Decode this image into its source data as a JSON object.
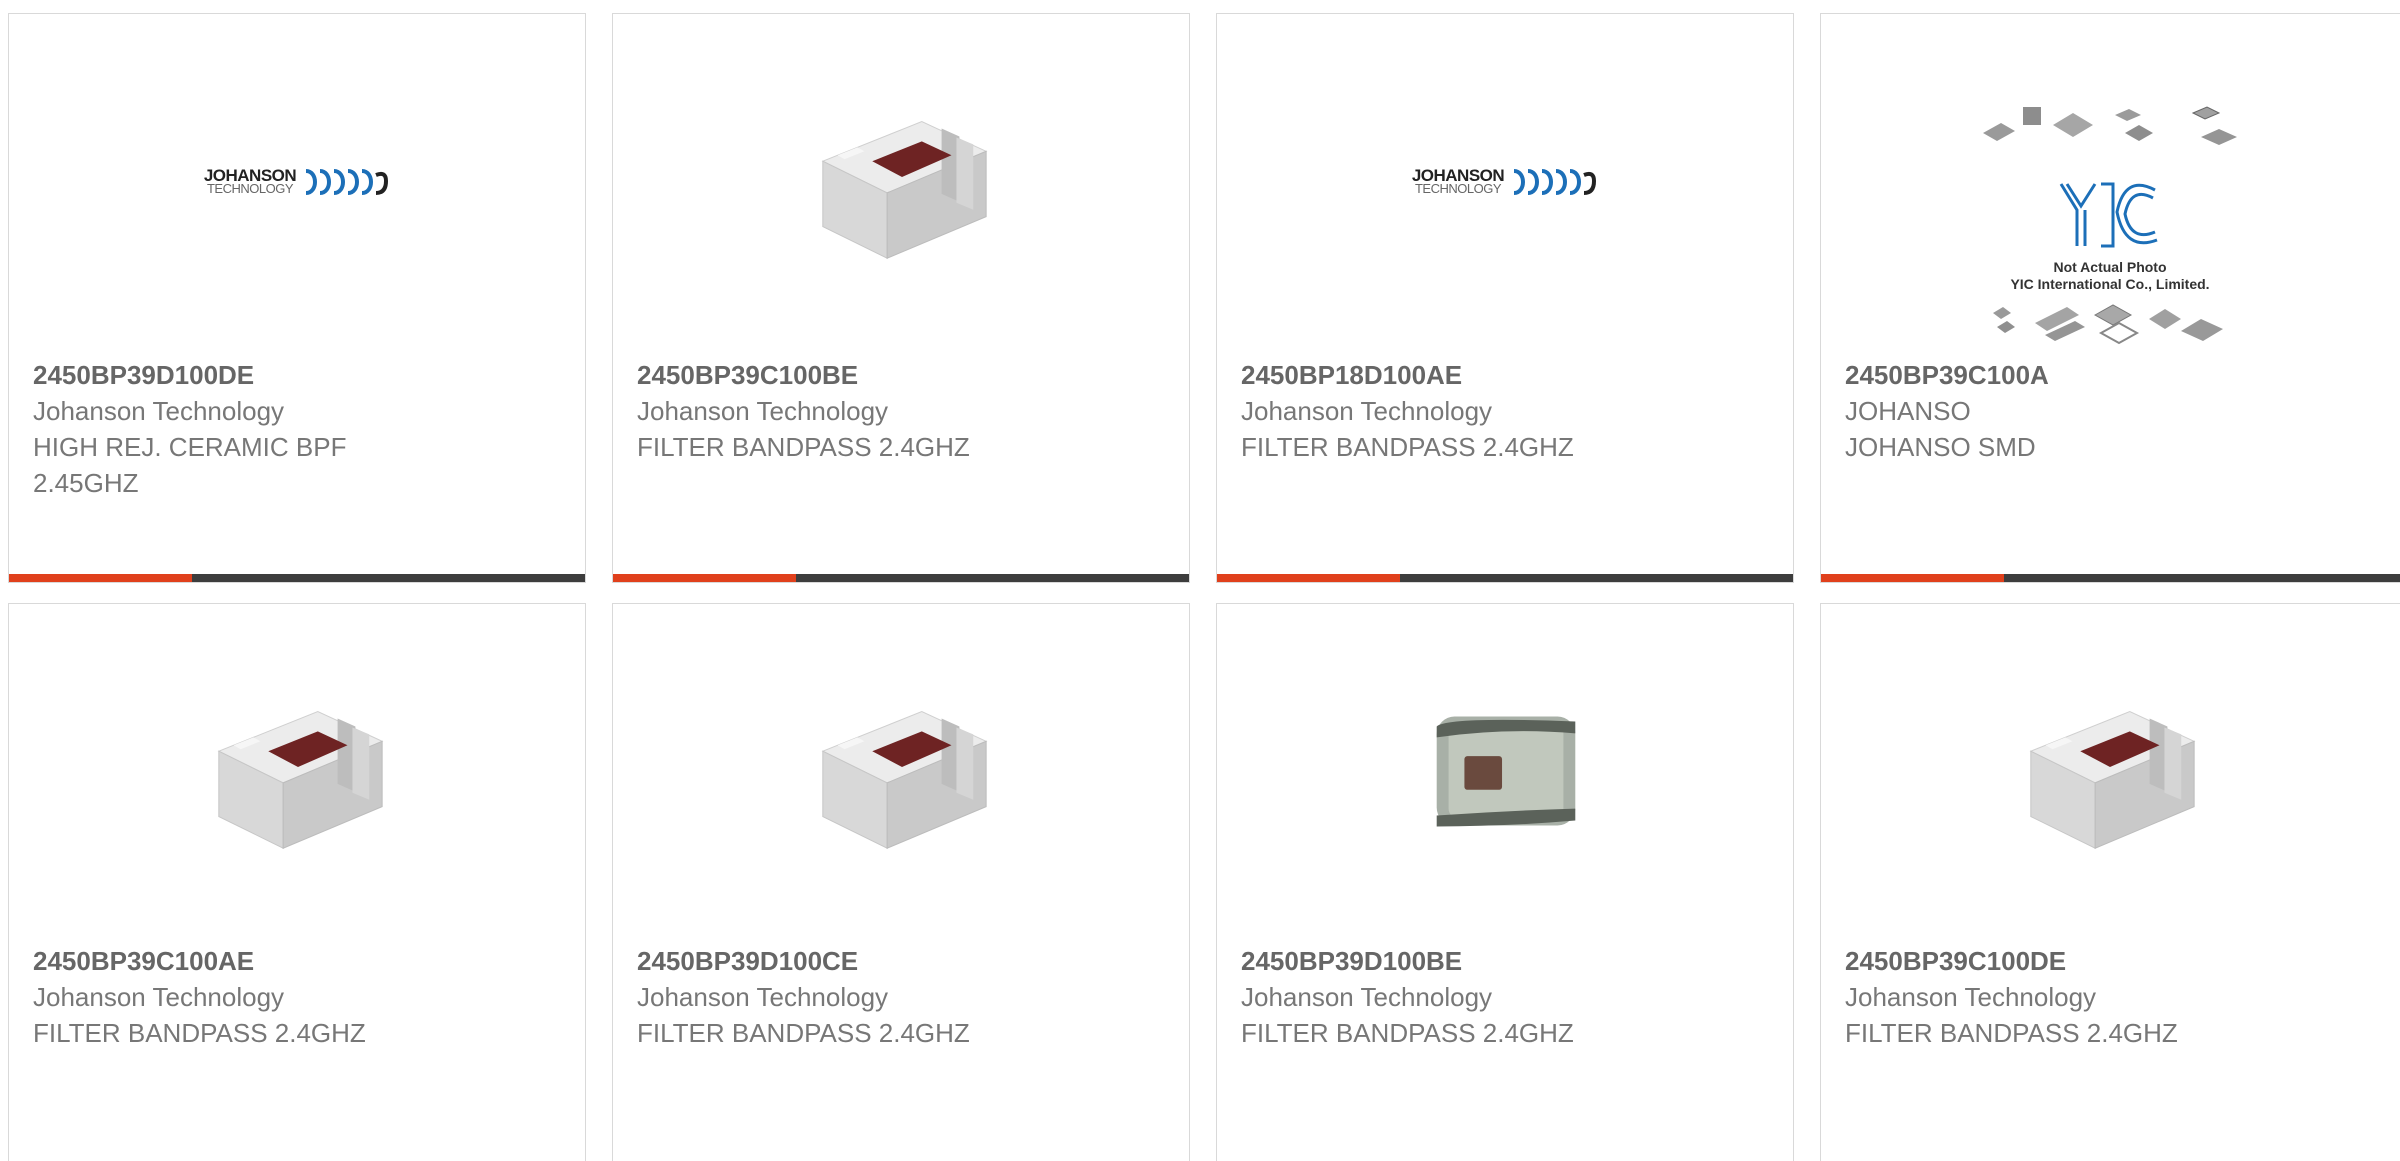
{
  "products": [
    {
      "part_number": "2450BP39D100DE",
      "manufacturer": "Johanson Technology",
      "description_lines": [
        "HIGH REJ. CERAMIC BPF",
        "2.45GHZ"
      ],
      "image": "johanson-logo",
      "logo_line1": "JOHANSON",
      "logo_line2": "TECHNOLOGY"
    },
    {
      "part_number": "2450BP39C100BE",
      "manufacturer": "Johanson Technology",
      "description_lines": [
        "FILTER BANDPASS 2.4GHZ"
      ],
      "image": "ceramic-chip-photo"
    },
    {
      "part_number": "2450BP18D100AE",
      "manufacturer": "Johanson Technology",
      "description_lines": [
        "FILTER BANDPASS 2.4GHZ"
      ],
      "image": "johanson-logo",
      "logo_line1": "JOHANSON",
      "logo_line2": "TECHNOLOGY"
    },
    {
      "part_number": "2450BP39C100A",
      "manufacturer": "JOHANSO",
      "description_lines": [
        "JOHANSO SMD"
      ],
      "image": "yic-placeholder",
      "placeholder_line1": "Not Actual Photo",
      "placeholder_line2": "YIC International Co., Limited."
    },
    {
      "part_number": "2450BP39C100AE",
      "manufacturer": "Johanson Technology",
      "description_lines": [
        "FILTER BANDPASS 2.4GHZ"
      ],
      "image": "ceramic-chip-photo"
    },
    {
      "part_number": "2450BP39D100CE",
      "manufacturer": "Johanson Technology",
      "description_lines": [
        "FILTER BANDPASS 2.4GHZ"
      ],
      "image": "ceramic-chip-photo"
    },
    {
      "part_number": "2450BP39D100BE",
      "manufacturer": "Johanson Technology",
      "description_lines": [
        "FILTER BANDPASS 2.4GHZ"
      ],
      "image": "smd-chip-top-photo"
    },
    {
      "part_number": "2450BP39C100DE",
      "manufacturer": "Johanson Technology",
      "description_lines": [
        "FILTER BANDPASS 2.4GHZ"
      ],
      "image": "ceramic-chip-photo"
    }
  ],
  "colors": {
    "accent": "#e0401c",
    "bar_dark": "#3d3d3d",
    "card_border": "#d9d9d9",
    "text": "#666666"
  }
}
